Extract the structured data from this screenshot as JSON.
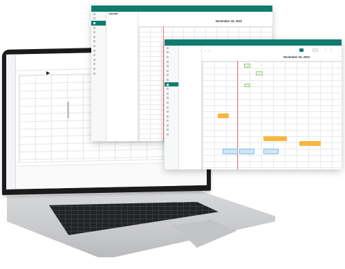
{
  "colors": {
    "brand": "#0f7c6e",
    "now_line": "#f07373",
    "event_orange": "#f6b740",
    "event_blue": "#cfe7f7",
    "event_green": "#e3f3dc"
  },
  "back_window": {
    "header_left": "",
    "header_mid": "",
    "header_right": "",
    "page_label": "Calendar",
    "date_title": "November 15, 2022",
    "sidebar_items": [
      {
        "label": ""
      },
      {
        "label": ""
      },
      {
        "label": ""
      },
      {
        "label": ""
      },
      {
        "label": ""
      },
      {
        "label": ""
      },
      {
        "label": ""
      },
      {
        "label": ""
      },
      {
        "label": ""
      },
      {
        "label": ""
      },
      {
        "label": ""
      },
      {
        "label": ""
      },
      {
        "label": ""
      },
      {
        "label": ""
      }
    ],
    "filter_rows": [
      "",
      "",
      "",
      "",
      "",
      ""
    ]
  },
  "front_window": {
    "date_title": "November 15, 2022",
    "toolbar": {
      "primary_btn": "",
      "today_btn": ""
    },
    "sidebar_items": [
      {
        "label": ""
      },
      {
        "label": ""
      },
      {
        "label": ""
      },
      {
        "label": ""
      },
      {
        "label": ""
      },
      {
        "label": ""
      },
      {
        "label": ""
      },
      {
        "label": ""
      },
      {
        "label": ""
      },
      {
        "label": ""
      },
      {
        "label": ""
      },
      {
        "label": ""
      },
      {
        "label": ""
      },
      {
        "label": ""
      },
      {
        "label": ""
      },
      {
        "label": ""
      },
      {
        "label": ""
      },
      {
        "label": ""
      },
      {
        "label": ""
      },
      {
        "label": ""
      }
    ]
  },
  "laptop": {
    "cursor_glyph": "▶"
  }
}
